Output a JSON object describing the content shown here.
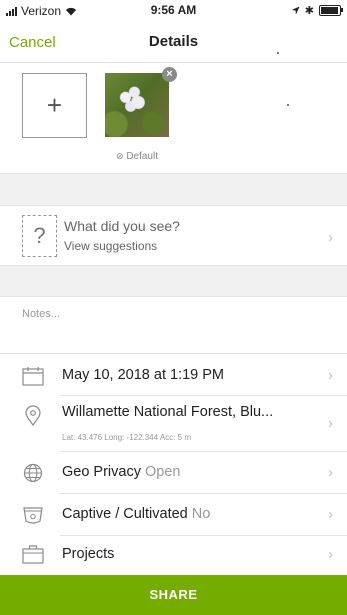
{
  "status_bar": {
    "carrier": "Verizon",
    "time": "9:56 AM"
  },
  "nav": {
    "cancel_label": "Cancel",
    "title": "Details"
  },
  "photos": {
    "add_label": "+",
    "default_label": "Default"
  },
  "species": {
    "question": "What did you see?",
    "suggestions": "View suggestions"
  },
  "notes": {
    "placeholder": "Notes..."
  },
  "rows": {
    "date": "May 10, 2018 at 1:19 PM",
    "location": "Willamette National Forest, Blu...",
    "location_coords": "Lat: 43.476  Long: -122.344  Acc: 5 m",
    "geo_privacy_label": "Geo Privacy",
    "geo_privacy_value": "Open",
    "captive_label": "Captive / Cultivated",
    "captive_value": "No",
    "projects_label": "Projects"
  },
  "footer": {
    "share_label": "SHARE"
  },
  "colors": {
    "accent": "#74ac00",
    "section_gray": "#f0f0f0"
  }
}
